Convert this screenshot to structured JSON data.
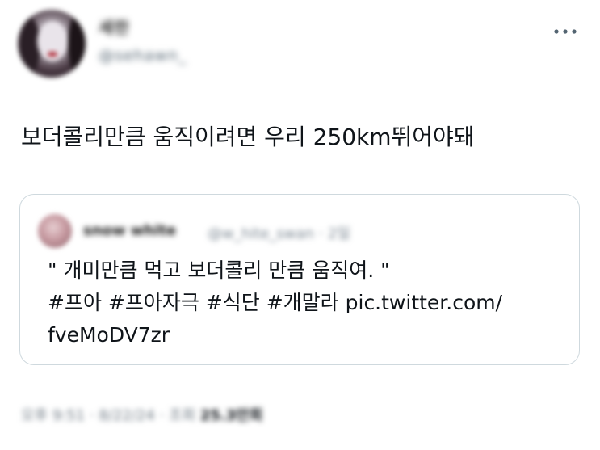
{
  "author": {
    "display_name": "세란",
    "handle": "@sehawn_"
  },
  "tweet": {
    "text": "보더콜리만큼 움직이려면 우리 250km뛰어야돼"
  },
  "quoted_tweet": {
    "author_name": "snow white",
    "author_handle": "@w_hite_swan · 2일",
    "line1": "\" 개미만큼 먹고 보더콜리 만큼 움직여. \"",
    "hashtags": [
      "#프아",
      "#프아자극",
      "#식단",
      "#개말라"
    ],
    "link_part1": "pic.twitter.com/",
    "link_part2": "fveMoDV7zr"
  },
  "meta": {
    "time": "오후 9:51 · 8/22/24 · 조회",
    "views": "25.3만회"
  },
  "icons": {
    "more": "more-horizontal-icon"
  },
  "colors": {
    "text": "#0f1419",
    "secondary": "#536471",
    "border": "#cfd9de"
  }
}
